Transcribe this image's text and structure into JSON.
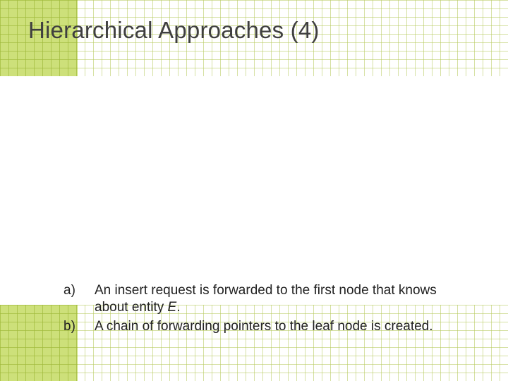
{
  "slide": {
    "title": "Hierarchical Approaches (4)"
  },
  "list": {
    "items": [
      {
        "marker": "a)",
        "text_before": "An insert request is forwarded to the first node that knows about entity ",
        "entity": "E",
        "text_after": "."
      },
      {
        "marker": "b)",
        "text_before": "A chain of forwarding pointers to the leaf node is created.",
        "entity": "",
        "text_after": ""
      }
    ]
  }
}
